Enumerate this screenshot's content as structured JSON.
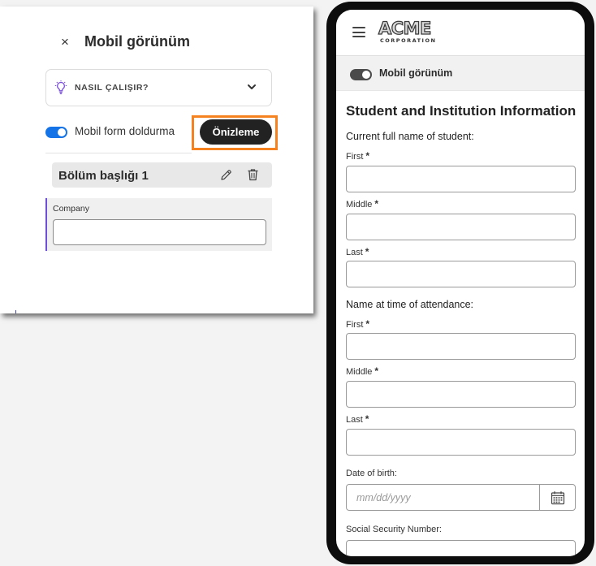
{
  "panel": {
    "close_symbol": "×",
    "title": "Mobil görünüm",
    "how_it_works": "NASIL ÇALIŞIR?",
    "toggle_label": "Mobil form doldurma",
    "preview_button": "Önizleme",
    "section_title": "Bölüm başlığı 1",
    "field_label": "Company"
  },
  "phone": {
    "logo_main": "ACME",
    "logo_sub": "CORPORATION",
    "mobile_view_label": "Mobil görünüm",
    "form_title": "Student and Institution Information",
    "group_current_name": "Current full name of student:",
    "group_attendance_name": "Name at time of attendance:",
    "first_label": "First",
    "middle_label": "Middle",
    "last_label": "Last",
    "required_mark": "*",
    "dob_label": "Date of birth:",
    "dob_placeholder": "mm/dd/yyyy",
    "ssn_label": "Social Security Number:"
  },
  "icons": {
    "close": "close-icon",
    "bulb": "lightbulb-icon",
    "chevron": "chevron-down-icon",
    "edit": "pencil-icon",
    "delete": "trash-icon",
    "menu": "hamburger-menu-icon",
    "calendar": "calendar-icon"
  },
  "colors": {
    "toggle_on": "#1473e6",
    "highlight": "#f5821f",
    "field_accent": "#6e4fd9",
    "preview_bg": "#222222"
  }
}
